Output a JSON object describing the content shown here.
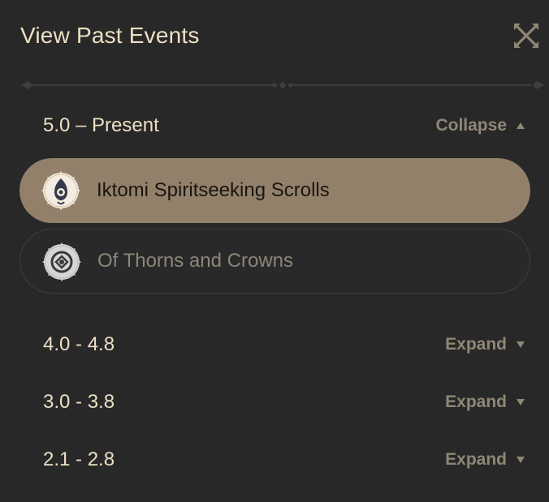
{
  "header": {
    "title": "View Past Events",
    "close_icon": "close-x-icon"
  },
  "colors": {
    "background": "#282828",
    "title_text": "#ecdfc3",
    "muted_text": "#8f8775",
    "selected_row": "#92806a"
  },
  "sections": [
    {
      "label": "5.0 – Present",
      "toggle_label": "Collapse",
      "toggle_icon": "triangle-up-icon",
      "expanded": true,
      "events": [
        {
          "label": "Iktomi Spiritseeking Scrolls",
          "icon": "event-emblem-icon",
          "selected": true
        },
        {
          "label": "Of Thorns and Crowns",
          "icon": "event-emblem-icon",
          "selected": false
        }
      ]
    },
    {
      "label": "4.0 - 4.8",
      "toggle_label": "Expand",
      "toggle_icon": "triangle-down-icon",
      "expanded": false
    },
    {
      "label": "3.0 - 3.8",
      "toggle_label": "Expand",
      "toggle_icon": "triangle-down-icon",
      "expanded": false
    },
    {
      "label": "2.1 - 2.8",
      "toggle_label": "Expand",
      "toggle_icon": "triangle-down-icon",
      "expanded": false
    }
  ]
}
